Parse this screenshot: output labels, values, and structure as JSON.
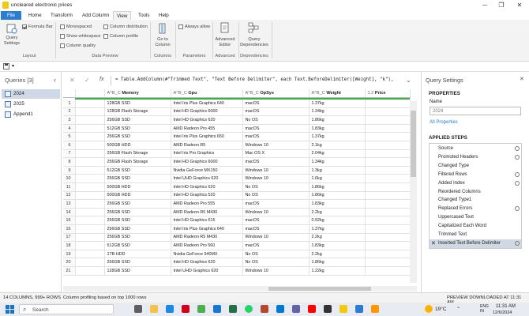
{
  "window": {
    "title": "uncleared electronic prices",
    "controls": [
      "─",
      "❐",
      "✕"
    ]
  },
  "menu": {
    "items": [
      "File",
      "Home",
      "Transform",
      "Add Column",
      "View",
      "Tools",
      "Help"
    ],
    "active": "View"
  },
  "ribbon": {
    "query_settings": "Query Settings",
    "layout_group": "Layout",
    "formula_bar": "Formula Bar",
    "monospaced": "Monospaced",
    "show_whitespace": "Show whitespace",
    "column_quality": "Column quality",
    "column_distribution": "Column distribution",
    "column_profile": "Column profile",
    "data_preview_group": "Data Preview",
    "go_to_column": "Go to Column",
    "columns_group": "Columns",
    "always_allow": "Always allow",
    "parameters_group": "Parameters",
    "advanced_editor": "Advanced Editor",
    "advanced_group": "Advanced",
    "query_dependencies": "Query Dependencies",
    "dependencies_group": "Dependencies"
  },
  "queries": {
    "header": "Queries [3]",
    "items": [
      "2024",
      "2025",
      "Append1"
    ],
    "selected": "2024",
    "collapse": "‹"
  },
  "formula": {
    "text": "= Table.AddColumn(#\"Trimmed Text\", \"Text Before Delimiter\", each Text.BeforeDelimiter([Weight], \"k\"),",
    "cancel": "✕",
    "confirm": "✓",
    "fx": "fx"
  },
  "table": {
    "columns": [
      "",
      "Memory",
      "Gpu",
      "OpSys",
      "Weight",
      "Price"
    ],
    "type_icons": [
      "",
      "A^B_C",
      "A^B_C",
      "A^B_C",
      "A^B_C",
      "1.2"
    ],
    "rows": [
      [
        "1",
        "128GB SSD",
        "Intel Iris Plus Graphics 640",
        "macOS",
        "1.37kg"
      ],
      [
        "2",
        "128GB Flash Storage",
        "Intel HD Graphics 6000",
        "macOS",
        "1.34kg"
      ],
      [
        "3",
        "256GB SSD",
        "Intel HD Graphics 620",
        "No OS",
        "1.86kg"
      ],
      [
        "4",
        "512GB SSD",
        "AMD Radeon Pro 455",
        "macOS",
        "1.83kg"
      ],
      [
        "5",
        "256GB SSD",
        "Intel Iris Plus Graphics 650",
        "macOS",
        "1.37kg"
      ],
      [
        "6",
        "500GB HDD",
        "AMD Radeon R5",
        "Windows 10",
        "2.1kg"
      ],
      [
        "7",
        "256GB Flash Storage",
        "Intel Iris Pro Graphics",
        "Mac OS X",
        "2.04kg"
      ],
      [
        "8",
        "256GB Flash Storage",
        "Intel HD Graphics 6000",
        "macOS",
        "1.34kg"
      ],
      [
        "9",
        "512GB SSD",
        "Nvidia GeForce MX150",
        "Windows 10",
        "1.3kg"
      ],
      [
        "10",
        "256GB SSD",
        "Intel UHD Graphics 620",
        "Windows 10",
        "1.6kg"
      ],
      [
        "11",
        "500GB HDD",
        "Intel HD Graphics 620",
        "No OS",
        "1.86kg"
      ],
      [
        "12",
        "500GB HDD",
        "Intel HD Graphics 520",
        "No OS",
        "1.86kg"
      ],
      [
        "13",
        "256GB SSD",
        "AMD Radeon Pro 555",
        "macOS",
        "1.83kg"
      ],
      [
        "14",
        "256GB SSD",
        "AMD Radeon R5 M430",
        "Windows 10",
        "2.2kg"
      ],
      [
        "15",
        "256GB SSD",
        "Intel HD Graphics 615",
        "macOS",
        "0.92kg"
      ],
      [
        "16",
        "256GB SSD",
        "Intel Iris Plus Graphics 640",
        "macOS",
        "1.37kg"
      ],
      [
        "17",
        "256GB SSD",
        "AMD Radeon R5 M430",
        "Windows 10",
        "2.2kg"
      ],
      [
        "18",
        "512GB SSD",
        "AMD Radeon Pro 560",
        "macOS",
        "1.83kg"
      ],
      [
        "19",
        "1TB HDD",
        "Nvidia GeForce 940MX",
        "No OS",
        "2.2kg"
      ],
      [
        "20",
        "256GB SSD",
        "Intel HD Graphics 620",
        "No OS",
        "1.86kg"
      ],
      [
        "21",
        "128GB SSD",
        "Intel UHD Graphics 620",
        "Windows 10",
        "1.22kg"
      ]
    ]
  },
  "settings": {
    "header": "Query Settings",
    "close": "✕",
    "properties_title": "PROPERTIES",
    "name_label": "Name",
    "name_value": "2024",
    "all_properties": "All Properties",
    "applied_steps_title": "APPLIED STEPS",
    "steps": [
      {
        "label": "Source",
        "gear": true
      },
      {
        "label": "Promoted Headers",
        "gear": true
      },
      {
        "label": "Changed Type",
        "gear": false
      },
      {
        "label": "Filtered Rows",
        "gear": true
      },
      {
        "label": "Added Index",
        "gear": true
      },
      {
        "label": "Reordered Columns",
        "gear": false
      },
      {
        "label": "Changed Type1",
        "gear": false
      },
      {
        "label": "Replaced Errors",
        "gear": true
      },
      {
        "label": "Uppercased Text",
        "gear": false
      },
      {
        "label": "Capitalized Each Word",
        "gear": false
      },
      {
        "label": "Trimmed Text",
        "gear": false
      },
      {
        "label": "Inserted Text Before Delimiter",
        "gear": true
      }
    ],
    "selected_step": "Inserted Text Before Delimiter"
  },
  "status": {
    "left": "14 COLUMNS, 999+ ROWS",
    "profiling": "Column profiling based on top 1000 rows",
    "right": "PREVIEW DOWNLOADED AT 11:31 AM"
  },
  "taskbar": {
    "search_placeholder": "Search",
    "temperature": "19°C",
    "language": "ENG\nIN",
    "time": "11:31 AM",
    "date": "12/6/2024"
  },
  "colors": {
    "file_blue": "#2b7cd3",
    "quality_green": "#3cb043",
    "ribbon_bg": "#f3f3f3",
    "selected_row": "#cfd8e6"
  }
}
